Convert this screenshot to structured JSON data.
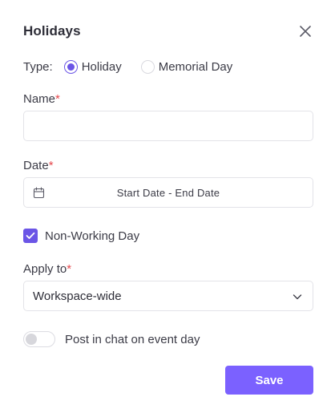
{
  "dialog": {
    "title": "Holidays"
  },
  "type_field": {
    "label": "Type:",
    "options": [
      {
        "label": "Holiday",
        "selected": true
      },
      {
        "label": "Memorial Day",
        "selected": false
      }
    ]
  },
  "name_field": {
    "label": "Name",
    "required_mark": "*",
    "value": "",
    "placeholder": ""
  },
  "date_field": {
    "label": "Date",
    "required_mark": "*",
    "placeholder": "Start Date - End Date",
    "icon": "calendar-icon"
  },
  "non_working": {
    "label": "Non-Working Day",
    "checked": true
  },
  "apply_to": {
    "label": "Apply to",
    "required_mark": "*",
    "selected": "Workspace-wide"
  },
  "post_toggle": {
    "label": "Post in chat on event day",
    "on": false
  },
  "actions": {
    "save_label": "Save"
  },
  "colors": {
    "accent": "#6b55e6",
    "button": "#7b61ff",
    "required": "#e5484d"
  }
}
